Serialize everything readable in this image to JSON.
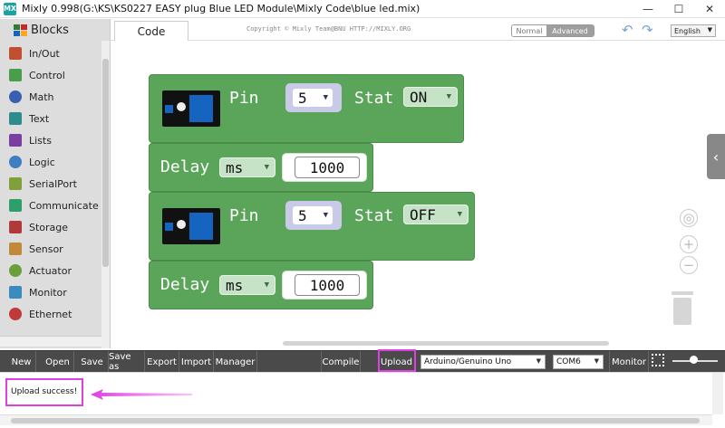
{
  "window": {
    "title": "Mixly 0.998(G:\\KS\\KS0227 EASY plug Blue LED Module\\Mixly Code\\blue led.mix)",
    "app_icon": "MX",
    "minimize": "—",
    "maximize": "☐",
    "close": "✕"
  },
  "sidebar": {
    "header": "Blocks",
    "items": [
      {
        "label": "In/Out",
        "icon": "inout-icon",
        "color": "#c0502f"
      },
      {
        "label": "Control",
        "icon": "gamepad-icon",
        "color": "#4a9d4a"
      },
      {
        "label": "Math",
        "icon": "math-icon",
        "color": "#3a5fb0"
      },
      {
        "label": "Text",
        "icon": "text-icon",
        "color": "#2f8c8c"
      },
      {
        "label": "Lists",
        "icon": "lists-icon",
        "color": "#7a3fa0"
      },
      {
        "label": "Logic",
        "icon": "bulb-icon",
        "color": "#3f7fc0"
      },
      {
        "label": "SerialPort",
        "icon": "pen-icon",
        "color": "#7fa03a"
      },
      {
        "label": "Communicate",
        "icon": "communicate-icon",
        "color": "#2f9f6a"
      },
      {
        "label": "Storage",
        "icon": "storage-icon",
        "color": "#b03a3a"
      },
      {
        "label": "Sensor",
        "icon": "sensor-icon",
        "color": "#c08a3a"
      },
      {
        "label": "Actuator",
        "icon": "actuator-icon",
        "color": "#6aa03a"
      },
      {
        "label": "Monitor",
        "icon": "monitor-icon",
        "color": "#3a8cc0"
      },
      {
        "label": "Ethernet",
        "icon": "ethernet-icon",
        "color": "#c03a3a"
      }
    ]
  },
  "tabs": {
    "code": "Code",
    "copyright": "Copyright © Mixly Team@BNU HTTP://MIXLY.ORG",
    "mode_normal": "Normal",
    "mode_advanced": "Advanced",
    "language": "English"
  },
  "blocks": [
    {
      "type": "pin",
      "pin_label": "Pin",
      "pin_value": "5",
      "stat_label": "Stat",
      "stat_value": "ON"
    },
    {
      "type": "delay",
      "label": "Delay",
      "unit": "ms",
      "value": "1000"
    },
    {
      "type": "pin",
      "pin_label": "Pin",
      "pin_value": "5",
      "stat_label": "Stat",
      "stat_value": "OFF"
    },
    {
      "type": "delay",
      "label": "Delay",
      "unit": "ms",
      "value": "1000"
    }
  ],
  "toolbar": {
    "new": "New",
    "open": "Open",
    "save": "Save",
    "save_as": "Save as",
    "export": "Export",
    "import": "Import",
    "manager": "Manager",
    "compile": "Compile",
    "upload": "Upload",
    "board": "Arduino/Genuino Uno",
    "port": "COM6",
    "monitor": "Monitor"
  },
  "output": {
    "message": "Upload success!"
  },
  "colors": {
    "block_green": "#5ba55b",
    "highlight": "#e040e0",
    "toolbar": "#4a4a4a"
  }
}
